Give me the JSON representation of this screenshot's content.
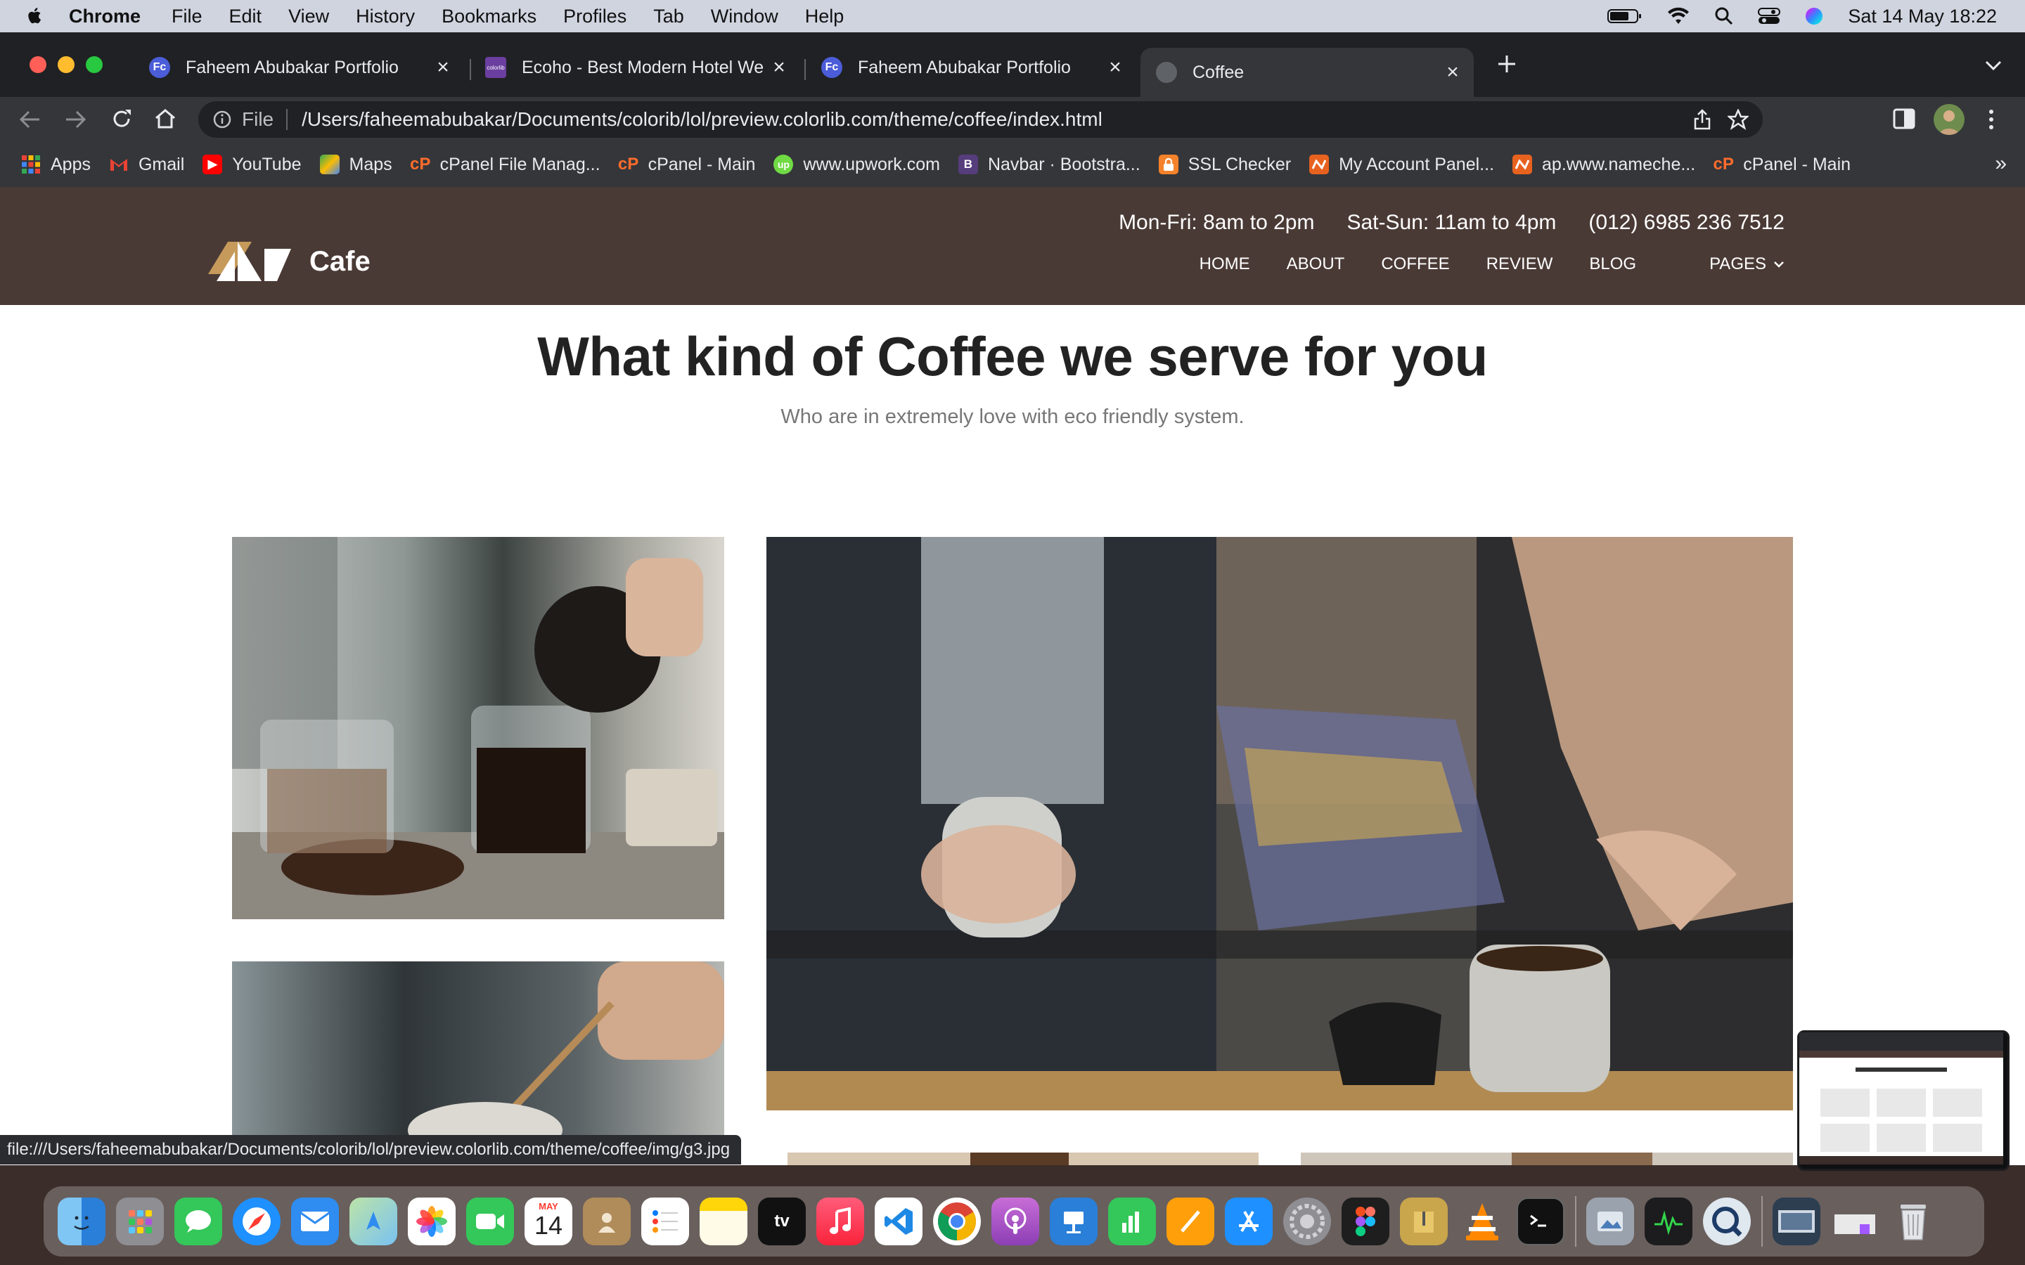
{
  "menubar": {
    "app": "Chrome",
    "items": [
      "File",
      "Edit",
      "View",
      "History",
      "Bookmarks",
      "Profiles",
      "Tab",
      "Window",
      "Help"
    ],
    "datetime": "Sat 14 May  18:22"
  },
  "tabs": [
    {
      "title": "Faheem Abubakar Portfolio",
      "fav": "Fc"
    },
    {
      "title": "Ecoho - Best Modern Hotel We",
      "fav": "colorlib"
    },
    {
      "title": "Faheem Abubakar Portfolio",
      "fav": "Fc"
    },
    {
      "title": "Coffee",
      "fav": ""
    }
  ],
  "address": {
    "scheme_label": "File",
    "url": "/Users/faheemabubakar/Documents/colorib/lol/preview.colorlib.com/theme/coffee/index.html"
  },
  "bookmarks": [
    "Apps",
    "Gmail",
    "YouTube",
    "Maps",
    "cPanel File Manag...",
    "cPanel - Main",
    "www.upwork.com",
    "Navbar · Bootstra...",
    "SSL Checker",
    "My Account Panel...",
    "ap.www.nameche...",
    "cPanel - Main"
  ],
  "site": {
    "brand": "Cafe",
    "hours_weekday": "Mon-Fri: 8am to 2pm",
    "hours_weekend": "Sat-Sun: 11am to 4pm",
    "phone": "(012) 6985 236 7512",
    "nav": [
      "HOME",
      "ABOUT",
      "COFFEE",
      "REVIEW",
      "BLOG",
      "PAGES"
    ],
    "heading": "What kind of Coffee we serve for you",
    "subheading": "Who are in extremely love with eco friendly system."
  },
  "status_url": "file:///Users/faheemabubakar/Documents/colorib/lol/preview.colorlib.com/theme/coffee/img/g3.jpg",
  "dock": {
    "calendar_month": "MAY",
    "calendar_day": "14",
    "tv_label": "tv"
  },
  "colors": {
    "header_bg": "#4a3a36",
    "logo_accent": "#c69a5a",
    "chrome_dark": "#202124",
    "chrome_toolbar": "#35363a"
  }
}
